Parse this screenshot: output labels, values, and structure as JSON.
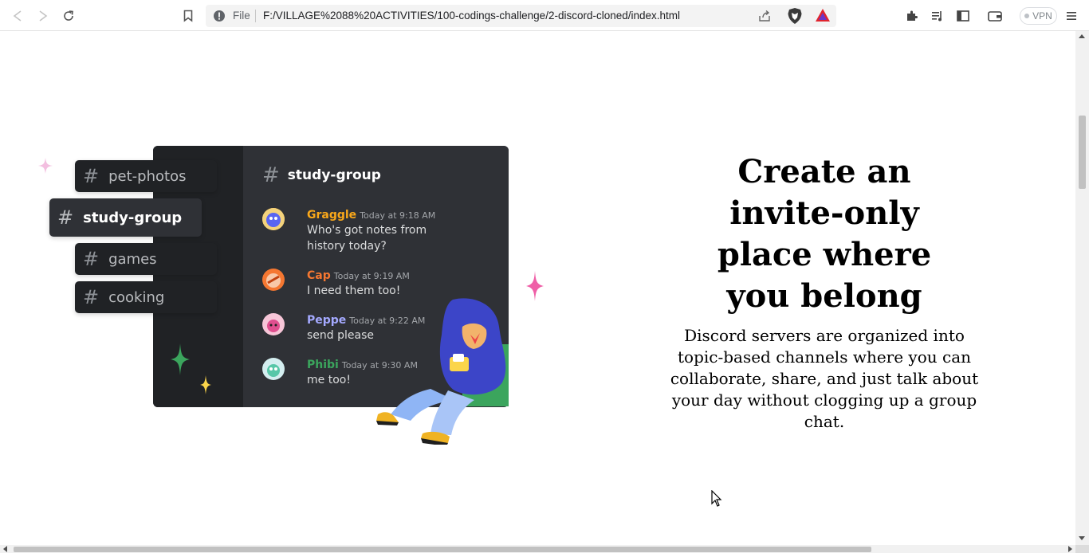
{
  "browser": {
    "nav": {
      "back_icon": "back-arrow-icon",
      "forward_icon": "forward-arrow-icon",
      "reload_icon": "reload-icon",
      "bookmark_icon": "bookmark-icon"
    },
    "address": {
      "scheme_label": "File",
      "url": "F:/VILLAGE%2088%20ACTIVITIES/100-codings-challenge/2-discord-cloned/index.html"
    },
    "right_icons": [
      "extensions-icon",
      "media-queue-icon",
      "sidebar-icon",
      "wallet-icon"
    ],
    "vpn_label": "VPN",
    "menu_icon": "hamburger-menu-icon"
  },
  "illustration": {
    "sidebar_channels": [
      {
        "label": "pet-photos",
        "active": false
      },
      {
        "label": "study-group",
        "active": true
      },
      {
        "label": "games",
        "active": false
      },
      {
        "label": "cooking",
        "active": false
      }
    ],
    "channel_header": "study-group",
    "messages": [
      {
        "author": "Graggle",
        "time": "Today at 9:18 AM",
        "text": "Who's got notes from history today?",
        "color": "#faa81a"
      },
      {
        "author": "Cap",
        "time": "Today at 9:19 AM",
        "text": "I need them too!",
        "color": "#f57731"
      },
      {
        "author": "Peppe",
        "time": "Today at 9:22 AM",
        "text": "send please",
        "color": "#a4a9ff"
      },
      {
        "author": "Phibi",
        "time": "Today at 9:30 AM",
        "text": "me too!",
        "color": "#3ba55d"
      }
    ]
  },
  "section": {
    "headline": "Create an invite-only place where you belong",
    "description": "Discord servers are organized into topic-based channels where you can collaborate, share, and just talk about your day without clogging up a group chat."
  },
  "colors": {
    "discord_dark": "#202225",
    "discord_mid": "#2f3136",
    "sparkle_pink": "#ef5fa7",
    "sparkle_green": "#3ba55d",
    "sparkle_yellow": "#fbd54a"
  }
}
